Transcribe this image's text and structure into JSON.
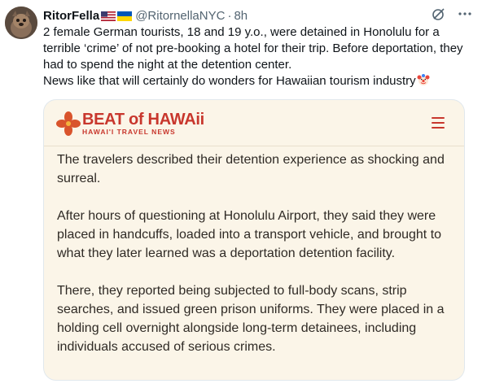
{
  "tweet": {
    "author_name": "RitorFella",
    "handle": "@RitornellaNYC",
    "separator": "·",
    "time": "8h",
    "text": "2 female German tourists, 18 and 19 y.o., were detained in Honolulu for a terrible ‘crime’ of not pre-booking a hotel for their trip. Before deportation, they had to spend the night at the detention center.\nNews like that will certainly do wonders for Hawaiian tourism industry"
  },
  "card": {
    "logo_main": "BEAT of HAWAii",
    "logo_sub": "HAWAI'I TRAVEL NEWS",
    "paragraphs": [
      "The travelers described their detention experience as shocking and surreal.",
      "After hours of questioning at Honolulu Airport, they said they were placed in handcuffs, loaded into a transport vehicle, and brought to what they later learned was a deportation detention facility.",
      "There, they reported being subjected to full-body scans, strip searches, and issued green prison uniforms. They were placed in a holding cell overnight alongside long-term detainees, including individuals accused of serious crimes."
    ]
  },
  "icons": {
    "flags": [
      "us-flag-icon",
      "ukraine-flag-icon"
    ],
    "emoji": "clown-face-icon",
    "actions": [
      "grok-icon",
      "more-icon"
    ],
    "menu": "hamburger-menu-icon"
  },
  "colors": {
    "card_background": "#fbf5e8",
    "brand_red": "#c8372d",
    "secondary_text": "#536471"
  }
}
